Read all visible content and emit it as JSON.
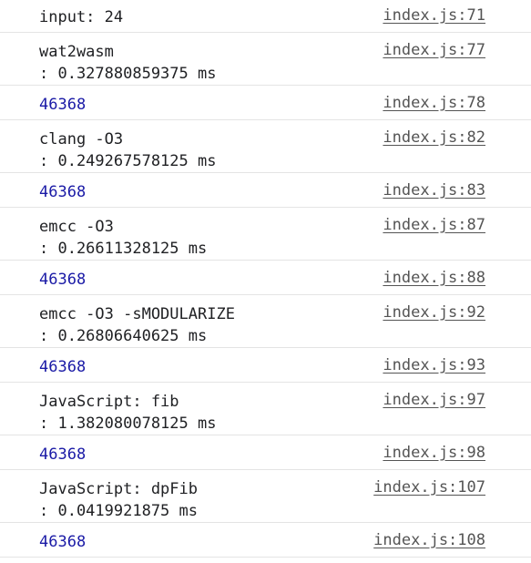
{
  "console": {
    "rows": [
      {
        "text_lines": [
          "input: 24"
        ],
        "source": "index.js:71",
        "kind": "log"
      },
      {
        "text_lines": [
          "wat2wasm",
          ": 0.327880859375 ms"
        ],
        "source": "index.js:77",
        "kind": "timer"
      },
      {
        "text_lines": [
          "46368"
        ],
        "source": "index.js:78",
        "kind": "number"
      },
      {
        "text_lines": [
          "clang -O3",
          ": 0.249267578125 ms"
        ],
        "source": "index.js:82",
        "kind": "timer"
      },
      {
        "text_lines": [
          "46368"
        ],
        "source": "index.js:83",
        "kind": "number"
      },
      {
        "text_lines": [
          "emcc -O3",
          ": 0.26611328125 ms"
        ],
        "source": "index.js:87",
        "kind": "timer"
      },
      {
        "text_lines": [
          "46368"
        ],
        "source": "index.js:88",
        "kind": "number"
      },
      {
        "text_lines": [
          "emcc -O3 -sMODULARIZE",
          ": 0.26806640625 ms"
        ],
        "source": "index.js:92",
        "kind": "timer"
      },
      {
        "text_lines": [
          "46368"
        ],
        "source": "index.js:93",
        "kind": "number"
      },
      {
        "text_lines": [
          "JavaScript: fib",
          ": 1.382080078125 ms"
        ],
        "source": "index.js:97",
        "kind": "timer"
      },
      {
        "text_lines": [
          "46368"
        ],
        "source": "index.js:98",
        "kind": "number"
      },
      {
        "text_lines": [
          "JavaScript: dpFib",
          ": 0.0419921875 ms"
        ],
        "source": "index.js:107",
        "kind": "timer"
      },
      {
        "text_lines": [
          "46368"
        ],
        "source": "index.js:108",
        "kind": "number"
      }
    ],
    "colors": {
      "text": "#202124",
      "number": "#1a1aa6",
      "source_link": "#545454",
      "divider": "#e4e4e4"
    }
  }
}
